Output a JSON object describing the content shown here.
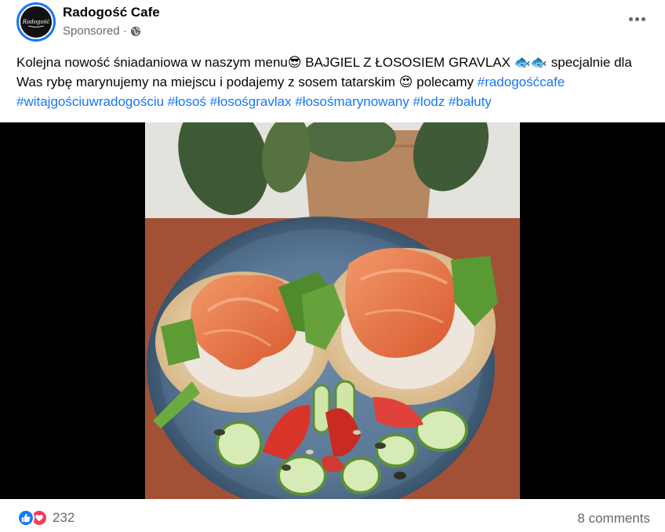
{
  "post": {
    "page_name": "Radogość Cafe",
    "sponsored_label": "Sponsored",
    "separator": "·",
    "logo_text": "Radogość",
    "text_parts": [
      {
        "text": "Kolejna nowość śniadaniowa w naszym menu😎 BAJGIEL Z ŁOSOSIEM GRAVLAX 🐟🐟 specjalnie dla Was rybę marynujemy na miejscu i podajemy z sosem tatarskim 😍 polecamy ",
        "tag": false
      },
      {
        "text": "#radogośćcafe",
        "tag": true
      },
      {
        "text": " ",
        "tag": false
      },
      {
        "text": "#witajgościuwradogościu",
        "tag": true
      },
      {
        "text": " ",
        "tag": false
      },
      {
        "text": "#łosoś",
        "tag": true
      },
      {
        "text": " ",
        "tag": false
      },
      {
        "text": "#łosośgravlax",
        "tag": true
      },
      {
        "text": " ",
        "tag": false
      },
      {
        "text": "#łosośmarynowany",
        "tag": true
      },
      {
        "text": " ",
        "tag": false
      },
      {
        "text": "#lodz",
        "tag": true
      },
      {
        "text": " ",
        "tag": false
      },
      {
        "text": "#bałuty",
        "tag": true
      }
    ]
  },
  "footer": {
    "reaction_count": "232",
    "comments_label": "8 comments"
  },
  "colors": {
    "link": "#1877f2",
    "like": "#1877f2",
    "love": "#f33e58",
    "muted": "#65676b"
  },
  "icons": {
    "more": "more-dots-icon",
    "audience": "globe-icon",
    "like": "like-reaction-icon",
    "love": "love-reaction-icon"
  }
}
